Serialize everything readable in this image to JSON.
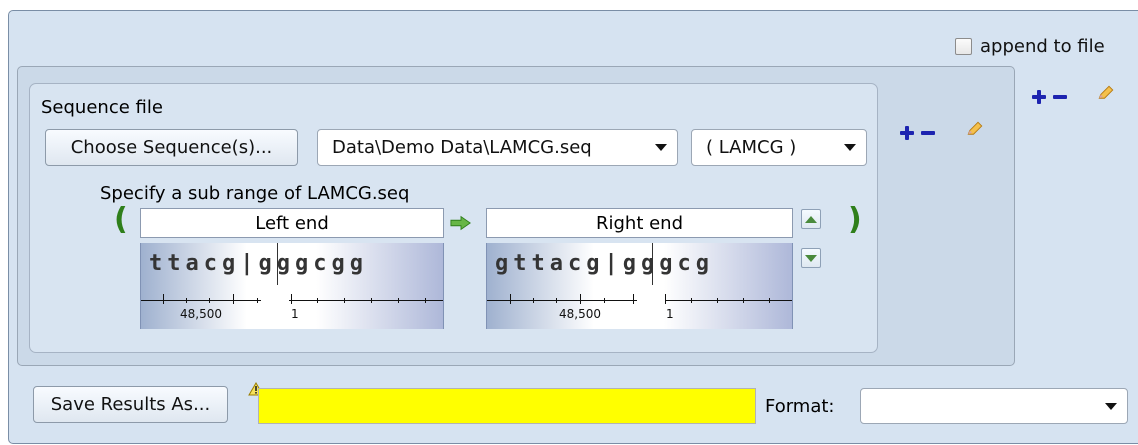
{
  "append": {
    "label": "append to file",
    "checked": false
  },
  "sequence": {
    "label": "Sequence file",
    "choose_button": "Choose Sequence(s)...",
    "file_value": "Data\\Demo Data\\LAMCG.seq",
    "name_value": "( LAMCG )",
    "subrange_label": "Specify a sub range of LAMCG.seq"
  },
  "range": {
    "open_paren": "(",
    "close_paren": ")",
    "left_end": "Left end",
    "right_end": "Right end",
    "left_seq": "ttacg|gggcgg",
    "right_seq": "gttacg|gggcg",
    "left_ruler_label": "48,500",
    "left_ruler_zero": "1",
    "right_ruler_label": "48,500",
    "right_ruler_zero": "1"
  },
  "footer": {
    "save_button": "Save Results As...",
    "format_label": "Format:"
  },
  "colors": {
    "panel": "#d6e3f1",
    "warning": "#ffff00",
    "accent_blue": "#1d24b0",
    "accent_green": "#2f7f1b"
  }
}
